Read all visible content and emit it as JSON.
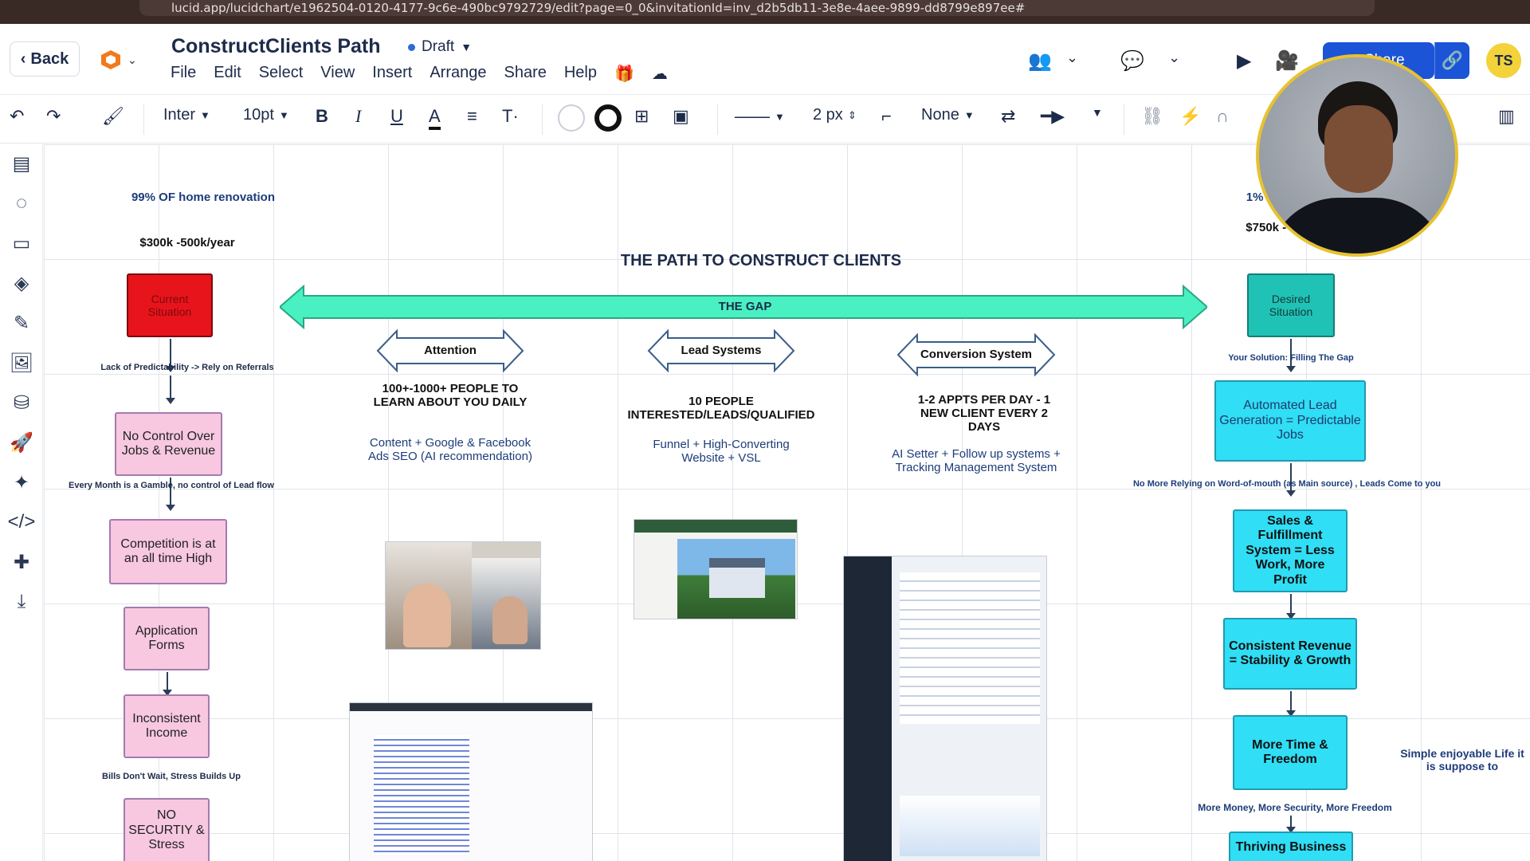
{
  "browser": {
    "url": "lucid.app/lucidchart/e1962504-0120-4177-9c6e-490bc9792729/edit?page=0_0&invitationId=inv_d2b5db11-3e8e-4aee-9899-dd8799e897ee#"
  },
  "header": {
    "back_label": "Back",
    "title": "ConstructClients Path",
    "status": "Draft",
    "menu": [
      "File",
      "Edit",
      "Select",
      "View",
      "Insert",
      "Arrange",
      "Share",
      "Help"
    ],
    "share_label": "Share",
    "user_initials": "TS"
  },
  "toolbar": {
    "font": "Inter",
    "font_size": "10pt",
    "line_width": "2 px",
    "endpoint": "None"
  },
  "diagram": {
    "title": "THE PATH TO CONSTRUCT CLIENTS",
    "gap_label": "THE GAP",
    "left": {
      "stat": "99% OF home renovation",
      "income": "$300k -500k/year",
      "current": "Current Situation",
      "note1": "Lack of Predictability -> Rely on Referrals",
      "box1": "No Control Over Jobs & Revenue",
      "note2": "Every Month is a Gamble, no control of Lead flow",
      "box2": "Competition is at an all time High",
      "box3": "Application Forms",
      "box4": "Inconsistent Income",
      "note3": "Bills Don't Wait, Stress Builds Up",
      "box5": "NO SECURTIY & Stress"
    },
    "attention": {
      "label": "Attention",
      "headline": "100+-1000+ PEOPLE TO LEARN ABOUT YOU DAILY",
      "detail": "Content + Google & Facebook Ads SEO (AI recommendation)"
    },
    "lead": {
      "label": "Lead Systems",
      "headline": "10 PEOPLE INTERESTED/LEADS/QUALIFIED",
      "detail": "Funnel + High-Converting Website + VSL"
    },
    "conversion": {
      "label": "Conversion System",
      "headline": "1-2 APPTS PER DAY - 1 NEW CLIENT EVERY 2 DAYS",
      "detail": "AI Setter + Follow up systems + Tracking Management System"
    },
    "right": {
      "stat": "1% of ho",
      "income": "$750k - $",
      "desired": "Desired Situation",
      "note1": "Your Solution: Filling The Gap",
      "box1": "Automated Lead Generation = Predictable  Jobs",
      "note2": "No More Relying on Word-of-mouth (as Main source) , Leads Come to you",
      "box2": "Sales & Fulfillment System = Less Work, More Profit",
      "box3": "Consistent Revenue = Stability & Growth",
      "box4": "More Time & Freedom",
      "note3": "More Money, More Security, More Freedom",
      "box5": "Thriving Business",
      "side_note": "Simple enjoyable Life it is suppose to"
    }
  },
  "colors": {
    "gap_arrow": "#49f0c2",
    "red_box": "#e8141b",
    "teal_box": "#20c2b5",
    "cyan_box": "#30def5",
    "pink_box": "#f7c8e0",
    "brand_blue": "#1b54d6"
  }
}
